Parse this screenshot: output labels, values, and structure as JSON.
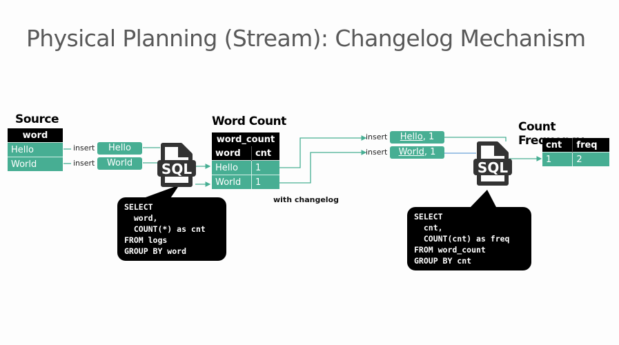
{
  "title": "Physical Planning (Stream): Changelog Mechanism",
  "source": {
    "heading": "Source",
    "column": "word",
    "rows": [
      "Hello",
      "World"
    ]
  },
  "source_events": [
    {
      "op": "insert",
      "value": "Hello"
    },
    {
      "op": "insert",
      "value": "World"
    }
  ],
  "sql1": {
    "icon_label": "SQL",
    "query": "SELECT\n  word,\n  COUNT(*) as cnt\nFROM logs\nGROUP BY word"
  },
  "word_count": {
    "heading": "Word Count",
    "table_name": "word_count",
    "columns": [
      "word",
      "cnt"
    ],
    "rows": [
      [
        "Hello",
        "1"
      ],
      [
        "World",
        "1"
      ]
    ],
    "note": "with changelog"
  },
  "changelog_events": [
    {
      "op": "insert",
      "key": "Hello",
      "rest": ", 1"
    },
    {
      "op": "insert",
      "key": "World",
      "rest": ", 1"
    }
  ],
  "sql2": {
    "icon_label": "SQL",
    "query": "SELECT\n  cnt,\n  COUNT(cnt) as freq\nFROM word_count\nGROUP BY cnt"
  },
  "count_frequency": {
    "heading": "Count Frequency",
    "columns": [
      "cnt",
      "freq"
    ],
    "rows": [
      [
        "1",
        "2"
      ]
    ]
  },
  "colors": {
    "accent": "#47ae93",
    "line": "#47ae93",
    "line_alt": "#6aa3d8",
    "dark": "#000000",
    "icon": "#333333"
  }
}
